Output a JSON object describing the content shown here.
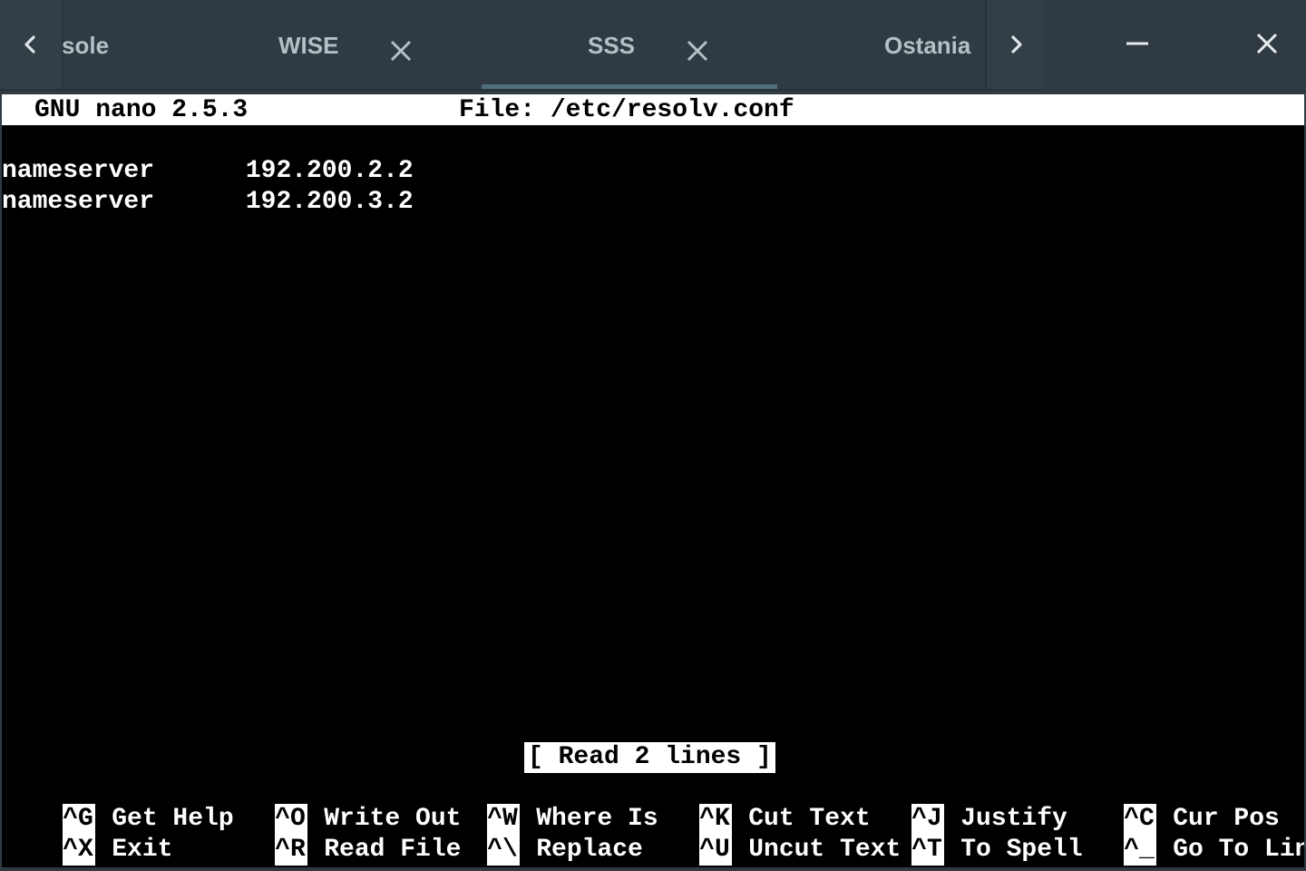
{
  "tabs": {
    "scroll_left_icon": "chevron-left-icon",
    "scroll_right_icon": "chevron-right-icon",
    "items": [
      {
        "label": "sole",
        "closable": false
      },
      {
        "label": "WISE",
        "closable": true
      },
      {
        "label": "SSS",
        "closable": true,
        "active": true
      },
      {
        "label": "Ostania",
        "closable": false
      }
    ],
    "minimize_icon": "minimize-icon",
    "close_window_icon": "close-icon",
    "accent_color": "#50707e",
    "background_color": "#2f3a42",
    "label_color": "#b5bfc6"
  },
  "nano": {
    "version": "GNU nano 2.5.3",
    "file_label": "File: /etc/resolv.conf",
    "lines": [
      "",
      "nameserver      192.200.2.2",
      "nameserver      192.200.3.2"
    ],
    "status": "[ Read 2 lines ]",
    "shortcuts": [
      {
        "key": "^G",
        "label": "Get Help"
      },
      {
        "key": "^O",
        "label": "Write Out"
      },
      {
        "key": "^W",
        "label": "Where Is"
      },
      {
        "key": "^K",
        "label": "Cut Text"
      },
      {
        "key": "^J",
        "label": "Justify"
      },
      {
        "key": "^C",
        "label": "Cur Pos"
      },
      {
        "key": "^X",
        "label": "Exit"
      },
      {
        "key": "^R",
        "label": "Read File"
      },
      {
        "key": "^\\",
        "label": "Replace"
      },
      {
        "key": "^U",
        "label": "Uncut Text"
      },
      {
        "key": "^T",
        "label": "To Spell"
      },
      {
        "key": "^_",
        "label": "Go To Line"
      }
    ]
  }
}
